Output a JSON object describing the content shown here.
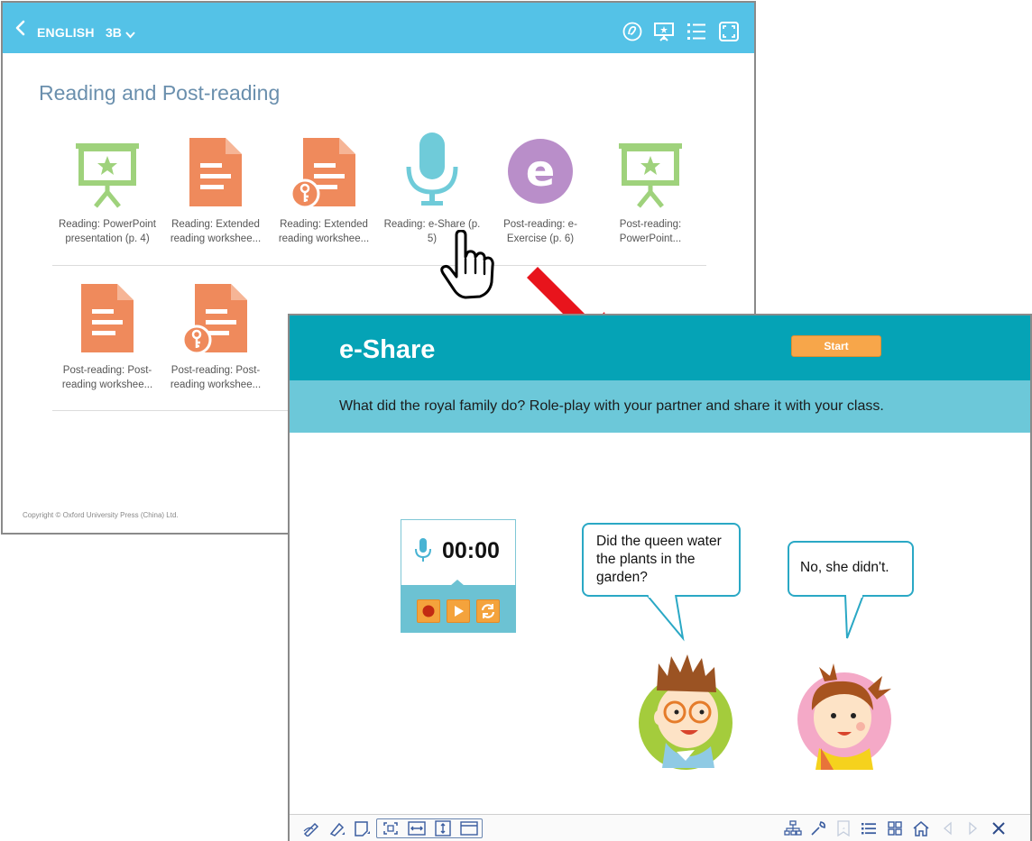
{
  "menu_window": {
    "subject": "ENGLISH",
    "grade": "3B",
    "section_title": "Reading and Post-reading",
    "tiles": [
      {
        "label": "Reading: PowerPoint presentation (p. 4)",
        "icon": "presentation-icon"
      },
      {
        "label": "Reading: Extended reading workshee...",
        "icon": "worksheet-icon"
      },
      {
        "label": "Reading: Extended reading workshee...",
        "icon": "worksheet-answer-key-icon"
      },
      {
        "label": "Reading: e-Share (p. 5)",
        "icon": "microphone-icon"
      },
      {
        "label": "Post-reading: e-Exercise (p. 6)",
        "icon": "e-exercise-icon"
      },
      {
        "label": "Post-reading: PowerPoint...",
        "icon": "presentation-icon"
      },
      {
        "label": "Post-reading: Post-reading workshee...",
        "icon": "worksheet-icon"
      },
      {
        "label": "Post-reading: Post-reading workshee...",
        "icon": "worksheet-answer-key-icon"
      }
    ],
    "copyright": "Copyright © Oxford University Press (China) Ltd.",
    "toolbar_icons": [
      "link-icon",
      "presentation-icon",
      "list-icon",
      "fullscreen-icon"
    ]
  },
  "eshare_window": {
    "title": "e-Share",
    "start_label": "Start",
    "question": "What did the royal family do? Role-play with your partner and share it with your class.",
    "recorder": {
      "time": "00:00",
      "buttons": [
        "record-icon",
        "play-icon",
        "reset-icon"
      ]
    },
    "bubble_boy": "Did the queen water the plants in the garden?",
    "bubble_girl": "No, she didn't.",
    "bottom_toolbar_icons": [
      "pen-icon",
      "highlighter-icon",
      "sticky-note-icon",
      "fit-page-icon",
      "fit-width-icon",
      "fit-height-icon",
      "window-icon",
      "sitemap-icon",
      "tools-icon",
      "bookmark-icon",
      "list-icon",
      "grid-icon",
      "home-icon",
      "prev-icon",
      "next-icon",
      "close-icon"
    ]
  },
  "colors": {
    "menu_bar": "#54c2e7",
    "eshare_header": "#05a3b6",
    "question_bar": "#6cc8d9",
    "start_button": "#f7a64a",
    "presentation_green": "#9fd27c",
    "worksheet_orange": "#ef8a5c",
    "mic_blue": "#6fcbd9",
    "e_purple": "#b98ec9",
    "arrow_red": "#e8141c"
  }
}
